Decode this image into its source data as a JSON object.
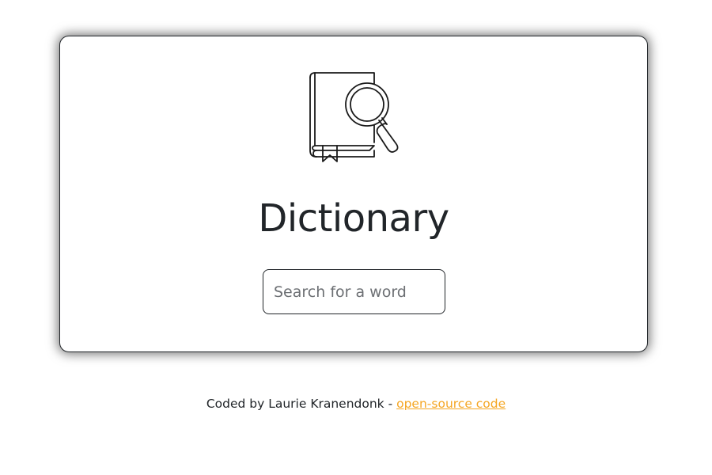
{
  "header": {
    "logo_icon": "book-magnifier-icon",
    "title": "Dictionary"
  },
  "search": {
    "placeholder": "Search for a word",
    "value": ""
  },
  "footer": {
    "credit_text": "Coded by Laurie Kranendonk - ",
    "link_label": "open-source code"
  },
  "colors": {
    "text": "#212529",
    "link": "#f5a623",
    "placeholder": "#6c6f73"
  }
}
